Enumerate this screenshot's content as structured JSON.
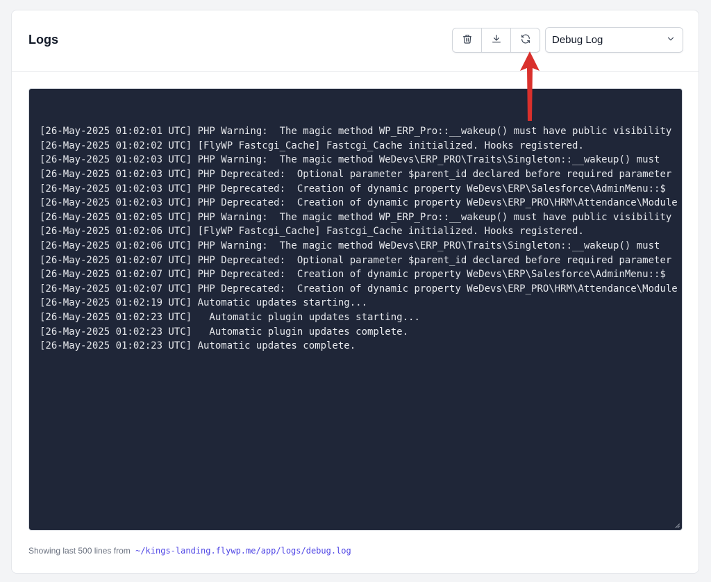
{
  "header": {
    "title": "Logs",
    "buttons": [
      {
        "icon": "trash-icon",
        "action": "delete"
      },
      {
        "icon": "download-icon",
        "action": "download"
      },
      {
        "icon": "refresh-icon",
        "action": "refresh"
      }
    ],
    "log_select": {
      "selected": "Debug Log"
    }
  },
  "log": {
    "lines": [
      "[26-May-2025 01:02:01 UTC] PHP Warning:  The magic method WP_ERP_Pro::__wakeup() must have public visibility",
      "[26-May-2025 01:02:02 UTC] [FlyWP Fastcgi_Cache] Fastcgi_Cache initialized. Hooks registered.",
      "[26-May-2025 01:02:03 UTC] PHP Warning:  The magic method WeDevs\\ERP_PRO\\Traits\\Singleton::__wakeup() must",
      "[26-May-2025 01:02:03 UTC] PHP Deprecated:  Optional parameter $parent_id declared before required parameter",
      "[26-May-2025 01:02:03 UTC] PHP Deprecated:  Creation of dynamic property WeDevs\\ERP\\Salesforce\\AdminMenu::$",
      "[26-May-2025 01:02:03 UTC] PHP Deprecated:  Creation of dynamic property WeDevs\\ERP_PRO\\HRM\\Attendance\\Module",
      "[26-May-2025 01:02:05 UTC] PHP Warning:  The magic method WP_ERP_Pro::__wakeup() must have public visibility",
      "[26-May-2025 01:02:06 UTC] [FlyWP Fastcgi_Cache] Fastcgi_Cache initialized. Hooks registered.",
      "[26-May-2025 01:02:06 UTC] PHP Warning:  The magic method WeDevs\\ERP_PRO\\Traits\\Singleton::__wakeup() must",
      "[26-May-2025 01:02:07 UTC] PHP Deprecated:  Optional parameter $parent_id declared before required parameter",
      "[26-May-2025 01:02:07 UTC] PHP Deprecated:  Creation of dynamic property WeDevs\\ERP\\Salesforce\\AdminMenu::$",
      "[26-May-2025 01:02:07 UTC] PHP Deprecated:  Creation of dynamic property WeDevs\\ERP_PRO\\HRM\\Attendance\\Module",
      "[26-May-2025 01:02:19 UTC] Automatic updates starting...",
      "[26-May-2025 01:02:23 UTC]   Automatic plugin updates starting...",
      "[26-May-2025 01:02:23 UTC]   Automatic plugin updates complete.",
      "[26-May-2025 01:02:23 UTC] Automatic updates complete."
    ]
  },
  "footer": {
    "prefix": "Showing last 500 lines from",
    "path": "~/kings-landing.flywp.me/app/logs/debug.log"
  },
  "colors": {
    "terminal_bg": "#1f2638",
    "terminal_text": "#e5e7eb",
    "annotation_arrow": "#d9302c",
    "path_link": "#4f46e5"
  }
}
